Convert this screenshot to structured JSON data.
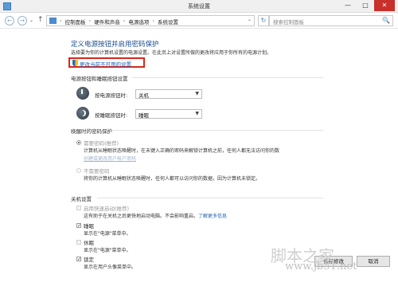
{
  "window": {
    "title": "系统设置",
    "minimize": "—",
    "maximize": "□",
    "close": "✕"
  },
  "nav": {
    "back": "←",
    "forward": "→",
    "history": "⌄",
    "up": "↑",
    "breadcrumbs": [
      "控制面板",
      "硬件和声音",
      "电源选项",
      "系统设置"
    ],
    "separator": "›",
    "dropdown": "⌄",
    "refresh": "↻",
    "search_placeholder": "搜索控制面板",
    "search_icon": "🔍"
  },
  "page": {
    "heading": "定义电源按钮并启用密码保护",
    "description": "选择要为你的计算机设置的电源设置。在此页上对设置所做的更改将应用于你所有的电源计划。",
    "change_settings_link": "更改当前不可用的设置"
  },
  "power_buttons": {
    "section_title": "电源按钮和睡眠按钮设置",
    "power_label": "按电源按钮时:",
    "power_value": "关机",
    "sleep_label": "按睡眠按钮时:",
    "sleep_value": "睡眠"
  },
  "wake_password": {
    "section_title": "唤醒时的密码保护",
    "require_label": "需要密码(推荐)",
    "require_desc": "计算机从睡眠状态唤醒时，在未键入正确的密码来解锁计算机之前，任何人都无法访问你的数",
    "require_link": "创建或更改用户帐户密码",
    "norequire_label": "不需要密码",
    "norequire_desc": "将你的计算机从睡眠状态唤醒时，任何人都可以访问你的数据，因为计算机未锁定。"
  },
  "shutdown": {
    "section_title": "关机设置",
    "fast_startup_label": "启用快速启动(推荐)",
    "fast_startup_desc": "这有助于在关机之后更快地启动电脑。不会影响重启。",
    "learn_more": "了解更多信息",
    "sleep_label": "睡眠",
    "sleep_desc": "显示在\"电源\"菜单中。",
    "hibernate_label": "休眠",
    "hibernate_desc": "显示在\"电源\"菜单中。",
    "lock_label": "锁定",
    "lock_desc": "显示在用户头像菜单中。",
    "check": "✓"
  },
  "footer": {
    "save": "保存修改",
    "cancel": "取消"
  },
  "watermark": {
    "text": "脚本之家",
    "url": "www.jb51.net"
  },
  "colors": {
    "heading": "#1e4f93",
    "link": "#1a5fb4",
    "highlight_box": "#d9261c"
  }
}
